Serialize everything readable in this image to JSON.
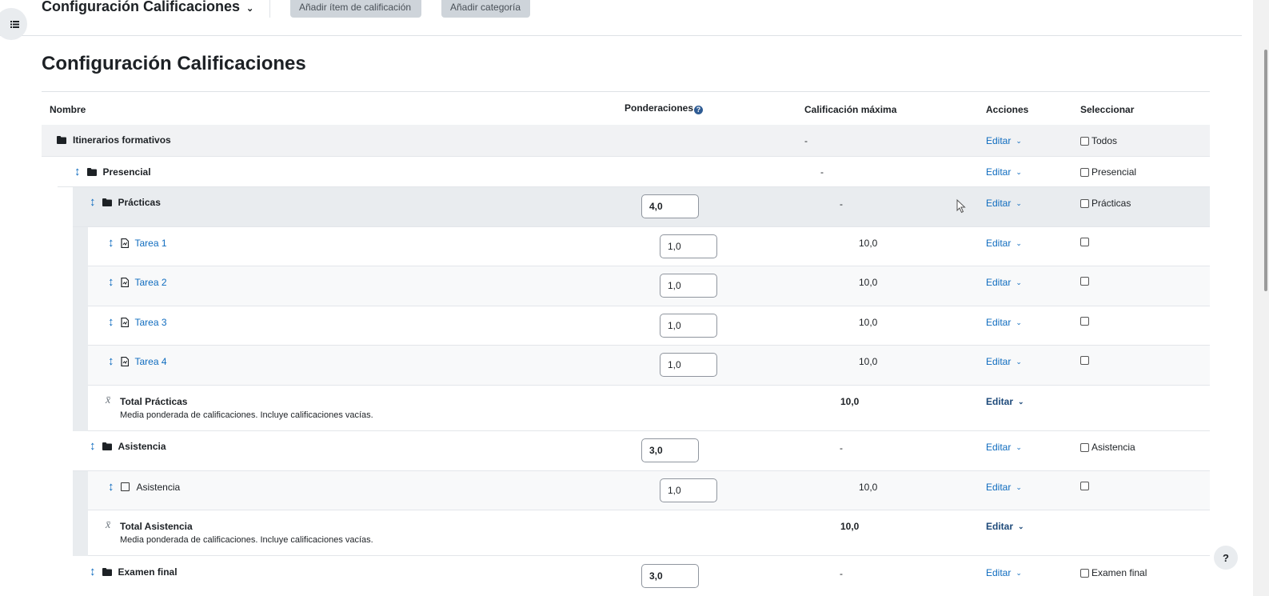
{
  "header": {
    "title": "Configuración Calificaciones",
    "add_item_label": "Añadir ítem de calificación",
    "add_category_label": "Añadir categoría"
  },
  "page_title": "Configuración Calificaciones",
  "columns": {
    "name": "Nombre",
    "weights": "Ponderaciones",
    "max_grade": "Calificación máxima",
    "actions": "Acciones",
    "select": "Seleccionar"
  },
  "edit_label": "Editar",
  "rows": [
    {
      "type": "category",
      "name": "Itinerarios formativos",
      "max": "-",
      "select": "Todos"
    },
    {
      "type": "category",
      "name": "Presencial",
      "max": "-",
      "select": "Presencial"
    },
    {
      "type": "category",
      "name": "Prácticas",
      "weight": "4,0",
      "max": "-",
      "select": "Prácticas"
    },
    {
      "type": "item",
      "name": "Tarea 1",
      "weight": "1,0",
      "max": "10,0"
    },
    {
      "type": "item",
      "name": "Tarea 2",
      "weight": "1,0",
      "max": "10,0"
    },
    {
      "type": "item",
      "name": "Tarea 3",
      "weight": "1,0",
      "max": "10,0"
    },
    {
      "type": "item",
      "name": "Tarea 4",
      "weight": "1,0",
      "max": "10,0"
    },
    {
      "type": "total",
      "name": "Total Prácticas",
      "description": "Media ponderada de calificaciones. Incluye calificaciones vacías.",
      "max": "10,0"
    },
    {
      "type": "category",
      "name": "Asistencia",
      "weight": "3,0",
      "max": "-",
      "select": "Asistencia"
    },
    {
      "type": "item",
      "name": "Asistencia",
      "weight": "1,0",
      "max": "10,0"
    },
    {
      "type": "total",
      "name": "Total Asistencia",
      "description": "Media ponderada de calificaciones. Incluye calificaciones vacías.",
      "max": "10,0"
    },
    {
      "type": "category",
      "name": "Examen final",
      "weight": "3,0",
      "max": "-",
      "select": "Examen final"
    }
  ],
  "help_button": "?",
  "colors": {
    "link": "#0f6cbf",
    "category_bg": "#f1f2f4",
    "row_alt_bg": "#f8f9fa"
  }
}
